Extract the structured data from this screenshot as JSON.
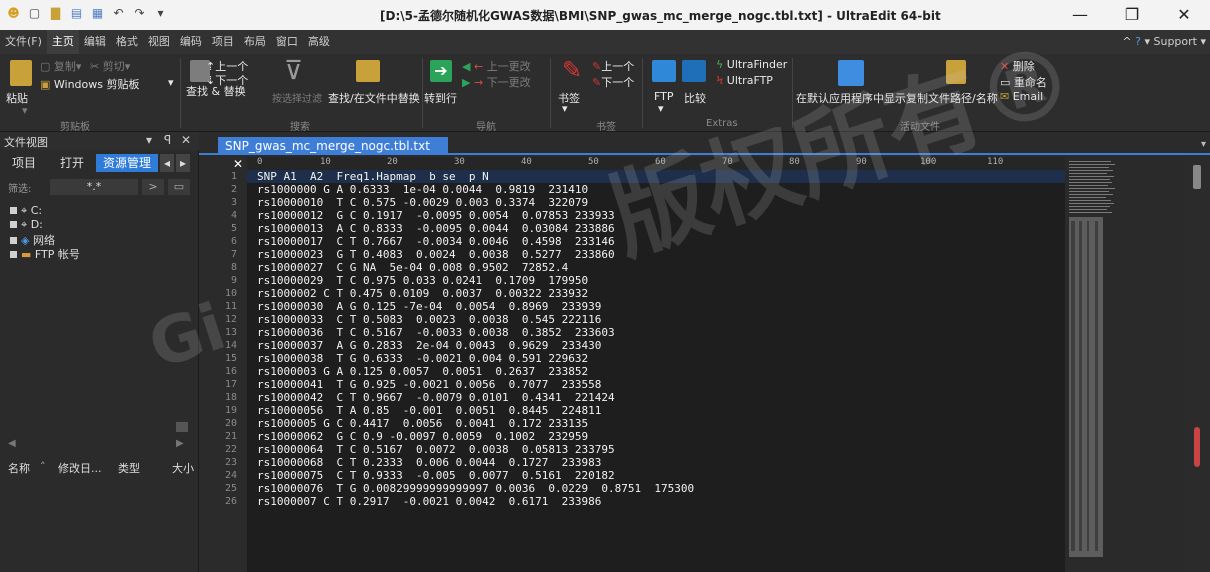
{
  "window": {
    "title": "[D:\\5-孟德尔随机化GWAS数据\\BMI\\SNP_gwas_mc_merge_nogc.tbl.txt] - UltraEdit 64-bit",
    "min_glyph": "—",
    "max_glyph": "❐",
    "close_glyph": "✕"
  },
  "menu": {
    "items": [
      "文件(F)",
      "主页",
      "编辑",
      "格式",
      "视图",
      "编码",
      "项目",
      "布局",
      "窗口",
      "高级"
    ],
    "support": "Support"
  },
  "ribbon": {
    "clipboard": {
      "paste": "粘贴",
      "copy": "复制",
      "cut": "剪切",
      "windows_clipboard": "Windows 剪贴板",
      "group": "剪贴板"
    },
    "search": {
      "prev": "上一个",
      "next": "下一个",
      "find_replace": "查找 & 替换",
      "filter": "按选择过滤",
      "find_in_files": "查找/在文件中替换",
      "group": "搜索"
    },
    "nav": {
      "goto": "转到行",
      "prev_change": "上一更改",
      "next_change": "下一更改",
      "group": "导航"
    },
    "bookmark": {
      "label": "书签",
      "prev": "上一个",
      "next": "下一个",
      "group": "书签"
    },
    "extras": {
      "ftp": "FTP",
      "compare": "比较",
      "ultrafinder": "UltraFinder",
      "ultraftp": "UltraFTP",
      "group": "Extras"
    },
    "active_file": {
      "open_default": "在默认应用程序中显示",
      "copy_path": "复制文件路径/名称",
      "delete": "删除",
      "rename": "重命名",
      "email": "Email",
      "group": "活动文件"
    }
  },
  "left_panel": {
    "header": "文件视图",
    "tabs": [
      "项目",
      "打开",
      "资源管理"
    ],
    "filter_label": "筛选:",
    "filter_value": "*.*",
    "tree": [
      "C:",
      "D:",
      "网络",
      "FTP 帐号"
    ],
    "columns": [
      "名称",
      "修改日...",
      "类型",
      "大小"
    ]
  },
  "editor": {
    "tab": "SNP_gwas_mc_merge_nogc.tbl.txt",
    "ruler_marks": [
      "0",
      "10",
      "20",
      "30",
      "40",
      "50",
      "60",
      "70",
      "80",
      "90",
      "100",
      "110"
    ],
    "line_numbers": [
      "1",
      "2",
      "3",
      "4",
      "5",
      "6",
      "7",
      "8",
      "9",
      "10",
      "11",
      "12",
      "13",
      "14",
      "15",
      "16",
      "17",
      "18",
      "19",
      "20",
      "21",
      "22",
      "23",
      "24",
      "25",
      "26"
    ],
    "lines": [
      "SNP A1  A2  Freq1.Hapmap  b se  p N",
      "rs1000000 G A 0.6333  1e-04 0.0044  0.9819  231410",
      "rs10000010  T C 0.575 -0.0029 0.003 0.3374  322079",
      "rs10000012  G C 0.1917  -0.0095 0.0054  0.07853 233933",
      "rs10000013  A C 0.8333  -0.0095 0.0044  0.03084 233886",
      "rs10000017  C T 0.7667  -0.0034 0.0046  0.4598  233146",
      "rs10000023  G T 0.4083  0.0024  0.0038  0.5277  233860",
      "rs10000027  C G NA  5e-04 0.008 0.9502  72852.4",
      "rs10000029  T C 0.975 0.033 0.0241  0.1709  179950",
      "rs1000002 C T 0.475 0.0109  0.0037  0.00322 233932",
      "rs10000030  A G 0.125 -7e-04  0.0054  0.8969  233939",
      "rs10000033  C T 0.5083  0.0023  0.0038  0.545 222116",
      "rs10000036  T C 0.5167  -0.0033 0.0038  0.3852  233603",
      "rs10000037  A G 0.2833  2e-04 0.0043  0.9629  233430",
      "rs10000038  T G 0.6333  -0.0021 0.004 0.591 229632",
      "rs1000003 G A 0.125 0.0057  0.0051  0.2637  233852",
      "rs10000041  T G 0.925 -0.0021 0.0056  0.7077  233558",
      "rs10000042  C T 0.9667  -0.0079 0.0101  0.4341  221424",
      "rs10000056  T A 0.85  -0.001  0.0051  0.8445  224811",
      "rs1000005 G C 0.4417  0.0056  0.0041  0.172 233135",
      "rs10000062  G C 0.9 -0.0097 0.0059  0.1002  232959",
      "rs10000064  T C 0.5167  0.0072  0.0038  0.05813 233795",
      "rs10000068  C T 0.2333  0.006 0.0044  0.1727  233983",
      "rs10000075  C T 0.9333  -0.005  0.0077  0.5161  220182",
      "rs10000076  T G 0.00829999999999997 0.0036  0.0229  0.8751  175300",
      "rs1000007 C T 0.2917  -0.0021 0.0042  0.6171  233986"
    ]
  },
  "watermark": {
    "text1": "版权所有®",
    "text2": "Gi"
  },
  "colors": {
    "accent": "#3e7ed6",
    "editor_bg": "#1e1e1e",
    "panel_bg": "#2b2b2b"
  }
}
